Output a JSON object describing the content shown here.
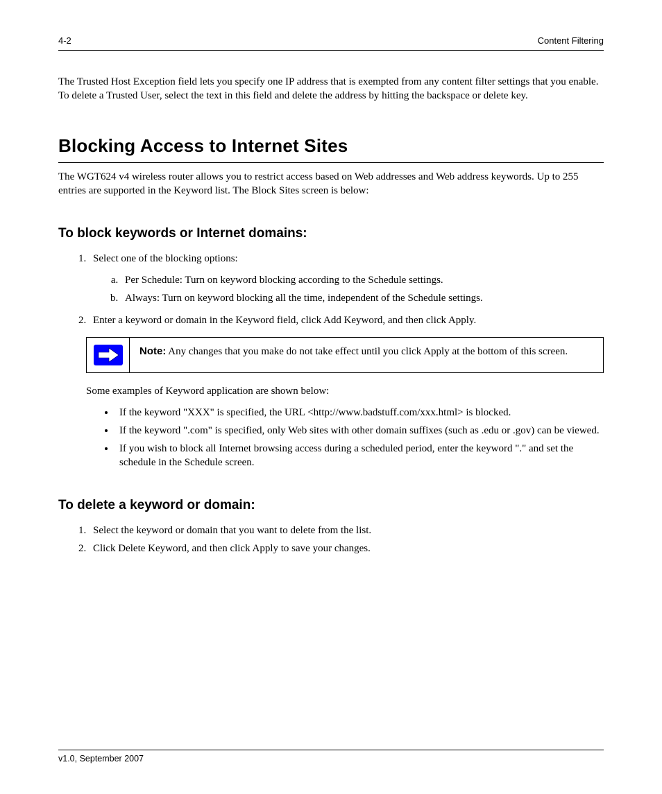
{
  "header": {
    "page_number": "4-2",
    "section_label": "Content Filtering"
  },
  "intro_paragraph": "The Trusted Host Exception field lets you specify one IP address that is exempted from any content filter settings that you enable. To delete a Trusted User, select the text in this field and delete the address by hitting the backspace or delete key.",
  "section": {
    "title": "Blocking Access to Internet Sites",
    "lead": "The WGT624 v4 wireless router allows you to restrict access based on Web addresses and Web address keywords. Up to 255 entries are supported in the Keyword list. The Block Sites screen is below:",
    "to_block_title": "To block keywords or Internet domains:",
    "steps": [
      "Select one of the blocking options:"
    ],
    "options": [
      "Per Schedule: Turn on keyword blocking according to the Schedule settings.",
      "Always: Turn on keyword blocking all the time, independent of the Schedule settings."
    ],
    "step2": "Enter a keyword or domain in the Keyword field, click Add Keyword, and then click Apply.",
    "note": {
      "label": "Note:",
      "text": "Any changes that you make do not take effect until you click Apply at the bottom of this screen."
    },
    "entries_lead": "Some examples of Keyword application are shown below:",
    "entries": [
      "If the keyword \"XXX\" is specified, the URL <http://www.badstuff.com/xxx.html> is blocked.",
      "If the keyword \".com\" is specified, only Web sites with other domain suffixes (such as .edu or .gov) can be viewed.",
      "If you wish to block all Internet browsing access during a scheduled period, enter the keyword \".\" and set the schedule in the Schedule screen."
    ],
    "to_delete_title": "To delete a keyword or domain:",
    "delete_steps": [
      "Select the keyword or domain that you want to delete from the list.",
      "Click Delete Keyword, and then click Apply to save your changes."
    ]
  },
  "footer": {
    "left": "v1.0, September 2007",
    "right": ""
  }
}
